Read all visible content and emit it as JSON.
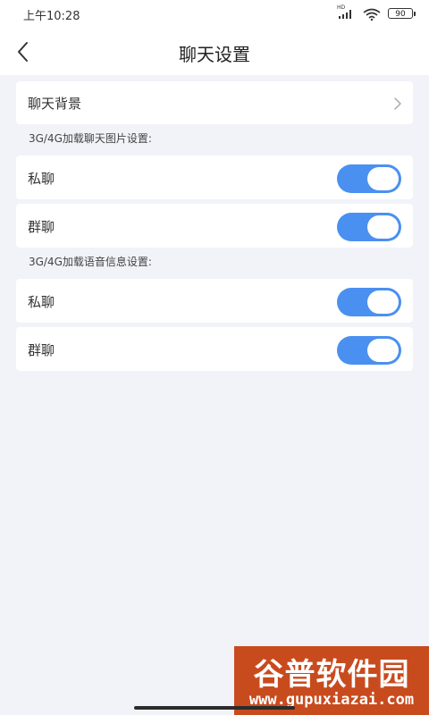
{
  "status_bar": {
    "time": "上午10:28",
    "network_label": "HD",
    "battery": "90"
  },
  "header": {
    "title": "聊天设置",
    "back_icon": "chevron-left-icon"
  },
  "chat_background": {
    "label": "聊天背景",
    "icon": "chevron-right-icon"
  },
  "sections": [
    {
      "label": "3G/4G加载聊天图片设置:",
      "rows": [
        {
          "label": "私聊",
          "enabled": true
        },
        {
          "label": "群聊",
          "enabled": true
        }
      ]
    },
    {
      "label": "3G/4G加载语音信息设置:",
      "rows": [
        {
          "label": "私聊",
          "enabled": true
        },
        {
          "label": "群聊",
          "enabled": true
        }
      ]
    }
  ],
  "watermark": {
    "brand": "谷普软件园",
    "url": "www.gupuxiazai.com"
  },
  "colors": {
    "toggle_on": "#4a90f0",
    "background": "#f1f3f9",
    "watermark": "#c84b1e"
  }
}
